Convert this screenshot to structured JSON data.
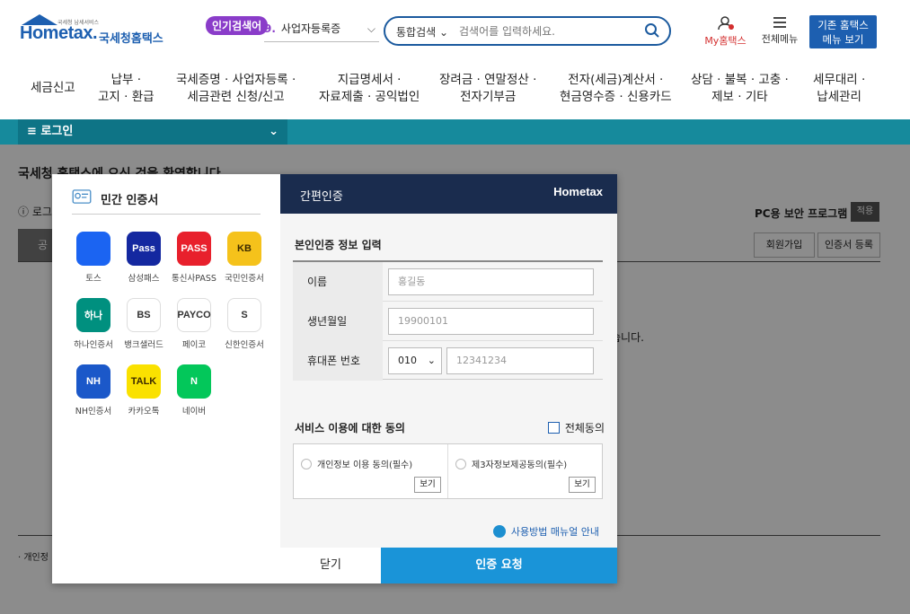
{
  "header": {
    "logo_small": "국세청 납세서비스",
    "logo_main": "Hometax.",
    "logo_kr": "국세청홈택스",
    "popular_badge": "인기검색어",
    "popular_num": "9.",
    "popular_term": "사업자등록증",
    "search_scope": "통합검색",
    "search_placeholder": "검색어를 입력하세요.",
    "my_hometax": "My홈택스",
    "all_menu": "전체메뉴",
    "old_menu_line1": "기존 홈택스",
    "old_menu_line2": "메뉴 보기"
  },
  "nav": [
    {
      "line1": "세금신고",
      "line2": ""
    },
    {
      "line1": "납부 ·",
      "line2": "고지 · 환급"
    },
    {
      "line1": "국세증명 · 사업자등록 ·",
      "line2": "세금관련 신청/신고"
    },
    {
      "line1": "지급명세서 ·",
      "line2": "자료제출 · 공익법인"
    },
    {
      "line1": "장려금 · 연말정산 ·",
      "line2": "전자기부금"
    },
    {
      "line1": "전자(세금)계산서 ·",
      "line2": "현금영수증 · 신용카드"
    },
    {
      "line1": "상담 · 불복 · 고충 ·",
      "line2": "제보 · 기타"
    },
    {
      "line1": "세무대리 ·",
      "line2": "납세관리"
    }
  ],
  "loginbar": {
    "label": "≡  로그인"
  },
  "background": {
    "welcome": "국세청 홈택스에 오신 것을 환영합니다",
    "notice": "ⓘ 로그",
    "tab": "공",
    "pc_security": "PC용 보안 프로그램",
    "apply": "적용",
    "join": "회원가입",
    "cert_register": "인증서 등록",
    "partial_text": "습니다.",
    "footer": "· 개인정"
  },
  "modal": {
    "left_title": "민간 인증서",
    "certs": [
      {
        "label": "토스",
        "icon": "toss-icon",
        "color": "#1b64f2",
        "text": ""
      },
      {
        "label": "삼성패스",
        "icon": "samsung-pass-icon",
        "color": "#1428a0",
        "text": "Pass"
      },
      {
        "label": "통신사PASS",
        "icon": "pass-icon",
        "color": "#e8202c",
        "text": "PASS"
      },
      {
        "label": "국민인증서",
        "icon": "kb-icon",
        "color": "#f5c21b",
        "text": "KB"
      },
      {
        "label": "하나인증서",
        "icon": "hana-icon",
        "color": "#00907f",
        "text": "하나"
      },
      {
        "label": "뱅크샐러드",
        "icon": "banksalad-icon",
        "color": "#ffffff",
        "text": "BS"
      },
      {
        "label": "페이코",
        "icon": "payco-icon",
        "color": "#ffffff",
        "text": "PAYCO"
      },
      {
        "label": "신한인증서",
        "icon": "shinhan-icon",
        "color": "#ffffff",
        "text": "S"
      },
      {
        "label": "NH인증서",
        "icon": "nh-icon",
        "color": "#1b58c9",
        "text": "NH"
      },
      {
        "label": "카카오톡",
        "icon": "kakaotalk-icon",
        "color": "#fae100",
        "text": "TALK"
      },
      {
        "label": "네이버",
        "icon": "naver-icon",
        "color": "#03c75a",
        "text": "N"
      }
    ],
    "right_title": "간편인증",
    "right_logo": "Hometax",
    "section_title": "본인인증 정보 입력",
    "name_label": "이름",
    "name_placeholder": "홍길동",
    "birth_label": "생년월일",
    "birth_placeholder": "19900101",
    "phone_label": "휴대폰 번호",
    "phone_prefix": "010",
    "phone_placeholder": "12341234",
    "consent_title": "서비스 이용에 대한 동의",
    "all_agree": "전체동의",
    "consent1": "개인정보 이용 동의(필수)",
    "consent2": "제3자정보제공동의(필수)",
    "view1": "보기",
    "view2": "보기",
    "manual": "사용방법 매뉴얼 안내",
    "close": "닫기",
    "request": "인증 요청"
  }
}
